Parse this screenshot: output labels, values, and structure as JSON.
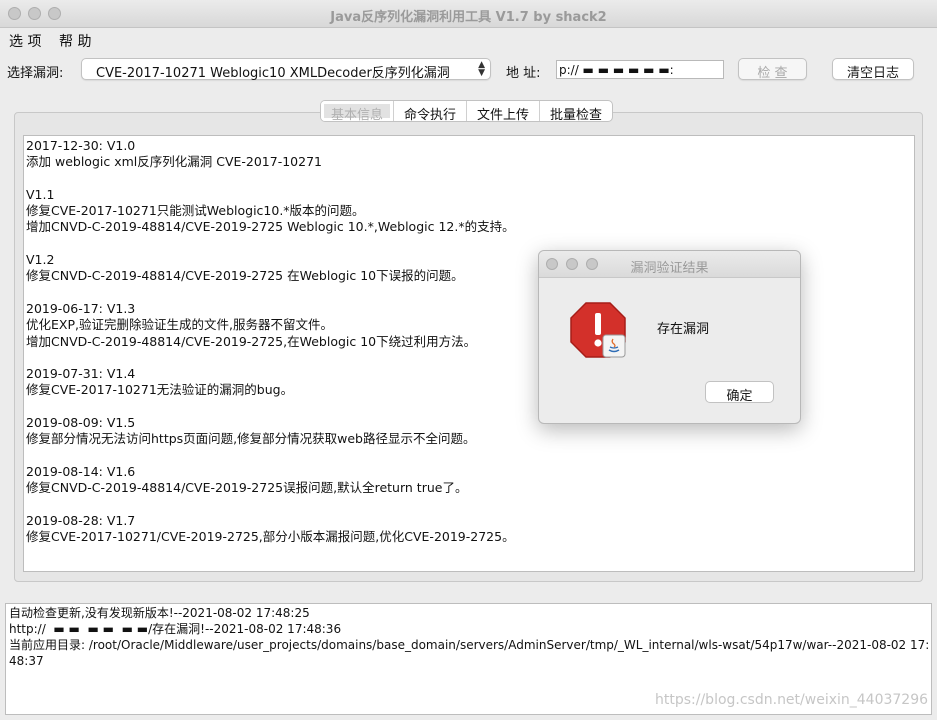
{
  "window": {
    "title": "Java反序列化漏洞利用工具 V1.7 by shack2"
  },
  "menu": {
    "items": [
      "选 项",
      "帮 助"
    ]
  },
  "toolbar": {
    "vuln_label": "选择漏洞:",
    "vuln_selected": "CVE-2017-10271 Weblogic10 XMLDecoder反序列化漏洞",
    "url_label": "地  址:",
    "url_value": "p://      ▬ ▬ ▬  ▬ ▬ ▬:",
    "check_label": "检 查",
    "clear_label": "清空日志"
  },
  "tabs": [
    "基本信息",
    "命令执行",
    "文件上传",
    "批量检查"
  ],
  "changelog": [
    "2017-12-30: V1.0",
    "添加 weblogic xml反序列化漏洞 CVE-2017-10271",
    "",
    "V1.1",
    "修复CVE-2017-10271只能测试Weblogic10.*版本的问题。",
    "增加CNVD-C-2019-48814/CVE-2019-2725 Weblogic 10.*,Weblogic 12.*的支持。",
    "",
    "V1.2",
    "修复CNVD-C-2019-48814/CVE-2019-2725 在Weblogic 10下误报的问题。",
    "",
    "2019-06-17: V1.3",
    "优化EXP,验证完删除验证生成的文件,服务器不留文件。",
    "增加CNVD-C-2019-48814/CVE-2019-2725,在Weblogic 10下绕过利用方法。",
    "",
    "2019-07-31: V1.4",
    "修复CVE-2017-10271无法验证的漏洞的bug。",
    "",
    "2019-08-09: V1.5",
    "修复部分情况无法访问https页面问题,修复部分情况获取web路径显示不全问题。",
    "",
    "2019-08-14: V1.6",
    "修复CNVD-C-2019-48814/CVE-2019-2725误报问题,默认全return true了。",
    "",
    "2019-08-28: V1.7",
    "修复CVE-2017-10271/CVE-2019-2725,部分小版本漏报问题,优化CVE-2019-2725。"
  ],
  "status_log": [
    "自动检查更新,没有发现新版本!--2021-08-02 17:48:25",
    "http://  ▬ ▬  ▬ ▬  ▬ ▬/存在漏洞!--2021-08-02 17:48:36",
    "当前应用目录: /root/Oracle/Middleware/user_projects/domains/base_domain/servers/AdminServer/tmp/_WL_internal/wls-wsat/54p17w/war--2021-08-02 17:48:37"
  ],
  "dialog": {
    "title": "漏洞验证结果",
    "message": "存在漏洞",
    "ok_label": "确定"
  },
  "watermark": "https://blog.csdn.net/weixin_44037296"
}
